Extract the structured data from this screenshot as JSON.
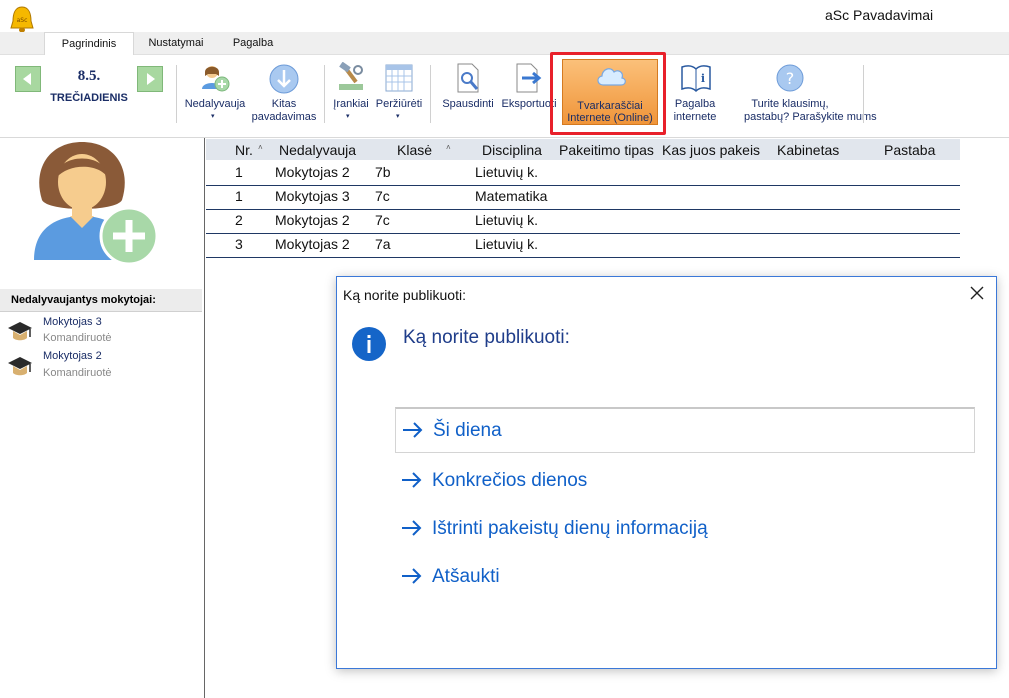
{
  "app": {
    "title": "aSc Pavadavimai",
    "logo_icon": "bell-icon"
  },
  "tabs": [
    {
      "label": "Pagrindinis",
      "active": true
    },
    {
      "label": "Nustatymai",
      "active": false
    },
    {
      "label": "Pagalba",
      "active": false
    }
  ],
  "ribbon": {
    "date_number": "8.5.",
    "date_day": "TREČIADIENIS",
    "prev_icon": "arrow-left-icon",
    "next_icon": "arrow-right-icon",
    "absent_label": "Nedalyvauja",
    "next_sub_label_1": "Kitas",
    "next_sub_label_2": "pavadavimas",
    "tools_label": "Įrankiai",
    "views_label": "Peržiūrėti",
    "print_label": "Spausdinti",
    "export_label": "Eksportuoti",
    "online_label_1": "Tvarkaraščiai",
    "online_label_2": "Internete (Online)",
    "help_label_1": "Pagalba",
    "help_label_2": "internete",
    "feedback_label_1": "Turite klausimų,",
    "feedback_label_2": "pastabų? Parašykite mums",
    "dropdown_glyph": "▾"
  },
  "left_pane": {
    "absent_header": "Nedalyvaujantys mokytojai:",
    "teachers": [
      {
        "name": "Mokytojas 3",
        "reason": "Komandiruotė"
      },
      {
        "name": "Mokytojas 2",
        "reason": "Komandiruotė"
      }
    ]
  },
  "table": {
    "columns": [
      "Nr.",
      "Nedalyvauja",
      "Klasė",
      "Disciplina",
      "Pakeitimo tipas",
      "Kas juos pakeis",
      "Kabinetas",
      "Pastaba"
    ],
    "sort_glyph": "˄",
    "rows": [
      {
        "nr": "1",
        "teacher": "Mokytojas 2",
        "class": "7b",
        "subject": "Lietuvių k."
      },
      {
        "nr": "1",
        "teacher": "Mokytojas 3",
        "class": "7c",
        "subject": "Matematika"
      },
      {
        "nr": "2",
        "teacher": "Mokytojas 2",
        "class": "7c",
        "subject": "Lietuvių k."
      },
      {
        "nr": "3",
        "teacher": "Mokytojas 2",
        "class": "7a",
        "subject": "Lietuvių k."
      }
    ]
  },
  "dialog": {
    "title": "Ką norite publikuoti:",
    "heading": "Ką norite publikuoti:",
    "options": [
      "Ši diena",
      "Konkrečios dienos",
      "Ištrinti pakeistų dienų informaciją",
      "Atšaukti"
    ],
    "selected_index": 0
  },
  "colors": {
    "accent": "#1060c8",
    "highlight": "#e8202a",
    "online_button": "#f0953a",
    "dark_text": "#1a2d66"
  }
}
